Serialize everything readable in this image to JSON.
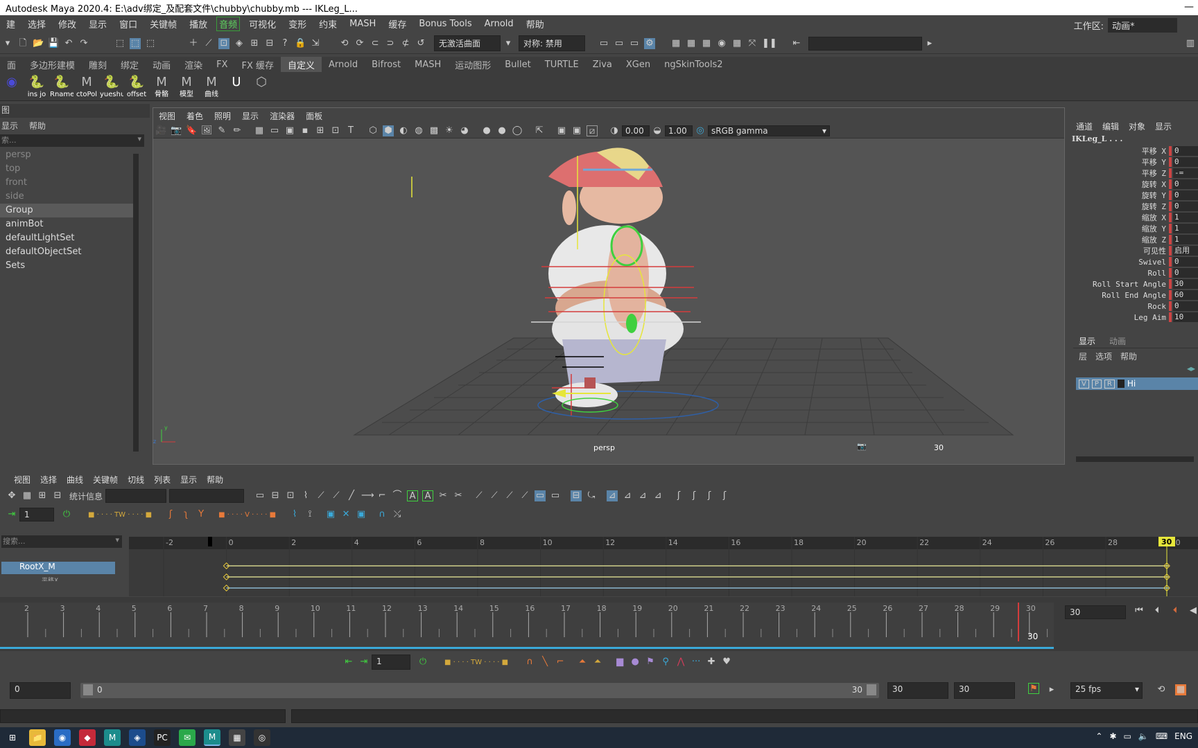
{
  "title": "Autodesk Maya 2020.4: E:\\adv绑定_及配套文件\\chubby\\chubby.mb  ---  IKLeg_L...",
  "window_controls": "—",
  "menu": [
    "建",
    "选择",
    "修改",
    "显示",
    "窗口",
    "关键帧",
    "播放",
    "音频",
    "可视化",
    "变形",
    "约束",
    "MASH",
    "缓存",
    "Bonus Tools",
    "Arnold",
    "帮助"
  ],
  "workspace": {
    "label": "工作区:",
    "value": "动画*"
  },
  "status": {
    "curve_field": "无激活曲面",
    "symmetry": "对称: 禁用"
  },
  "shelf_tabs": [
    "面",
    "多边形建模",
    "雕刻",
    "绑定",
    "动画",
    "渲染",
    "FX",
    "FX 缓存",
    "自定义",
    "Arnold",
    "Bifrost",
    "MASH",
    "运动图形",
    "Bullet",
    "TURTLE",
    "Ziva",
    "XGen",
    "ngSkinTools2"
  ],
  "shelf_active": "自定义",
  "shelf_items": [
    "",
    "ins jo",
    "Rname",
    "ctoPol",
    "yueshu",
    "offset",
    "骨骼",
    "模型",
    "曲线",
    "",
    ""
  ],
  "outliner": {
    "header": "图",
    "menu": [
      "显示",
      "帮助"
    ],
    "search": "索...",
    "items": [
      {
        "name": "persp",
        "dim": true
      },
      {
        "name": "top",
        "dim": true
      },
      {
        "name": "front",
        "dim": true
      },
      {
        "name": "side",
        "dim": true
      },
      {
        "name": "Group",
        "sel": true
      },
      {
        "name": "animBot"
      },
      {
        "name": "defaultLightSet"
      },
      {
        "name": "defaultObjectSet"
      },
      {
        "name": "Sets"
      }
    ]
  },
  "viewport": {
    "menu": [
      "视图",
      "着色",
      "照明",
      "显示",
      "渲染器",
      "面板"
    ],
    "exposure": "0.00",
    "gamma": "1.00",
    "colorspace": "sRGB gamma",
    "camera": "persp",
    "frame_label": "30"
  },
  "channel_box": {
    "menu": [
      "通道",
      "编辑",
      "对象",
      "显示"
    ],
    "object": "IKLeg_L . . .",
    "attrs": [
      {
        "n": "平移 X",
        "v": "0"
      },
      {
        "n": "平移 Y",
        "v": "0"
      },
      {
        "n": "平移 Z",
        "v": "-="
      },
      {
        "n": "旋转 X",
        "v": "0"
      },
      {
        "n": "旋转 Y",
        "v": "0"
      },
      {
        "n": "旋转 Z",
        "v": "0"
      },
      {
        "n": "缩放 X",
        "v": "1"
      },
      {
        "n": "缩放 Y",
        "v": "1"
      },
      {
        "n": "缩放 Z",
        "v": "1"
      },
      {
        "n": "可见性",
        "v": "启用"
      },
      {
        "n": "Swivel",
        "v": "0"
      },
      {
        "n": "Roll",
        "v": "0"
      },
      {
        "n": "Roll Start Angle",
        "v": "30"
      },
      {
        "n": "Roll End Angle",
        "v": "60"
      },
      {
        "n": "Rock",
        "v": "0"
      },
      {
        "n": "Leg Aim",
        "v": "10"
      }
    ]
  },
  "layers": {
    "tabs": [
      "显示",
      "动画"
    ],
    "menu": [
      "层",
      "选项",
      "帮助"
    ],
    "row": {
      "v": "V",
      "p": "P",
      "r": "R",
      "name": "Hi"
    }
  },
  "graph": {
    "menu": [
      "视图",
      "选择",
      "曲线",
      "关键帧",
      "切线",
      "列表",
      "显示",
      "帮助"
    ],
    "stats_label": "统计信息",
    "frame_field": "1",
    "search": "搜索...",
    "node": "RootX_M",
    "node2": "平移X",
    "ruler": [
      "-2",
      "0",
      "2",
      "4",
      "6",
      "8",
      "10",
      "12",
      "14",
      "16",
      "18",
      "20",
      "22",
      "24",
      "26",
      "28",
      "30"
    ],
    "value_label": "0",
    "current": "30"
  },
  "timeslider": {
    "ticks": [
      "2",
      "3",
      "4",
      "5",
      "6",
      "7",
      "8",
      "9",
      "10",
      "11",
      "12",
      "13",
      "14",
      "15",
      "16",
      "17",
      "18",
      "19",
      "20",
      "21",
      "22",
      "23",
      "24",
      "25",
      "26",
      "27",
      "28",
      "29",
      "30"
    ],
    "current_frame": "30",
    "current_field": "30"
  },
  "playback": {
    "frame_field": "1"
  },
  "range": {
    "start": "0",
    "range_start": "0",
    "range_end": "30",
    "end1": "30",
    "end2": "30",
    "fps": "25 fps"
  },
  "taskbar": {
    "lang": "ENG"
  }
}
